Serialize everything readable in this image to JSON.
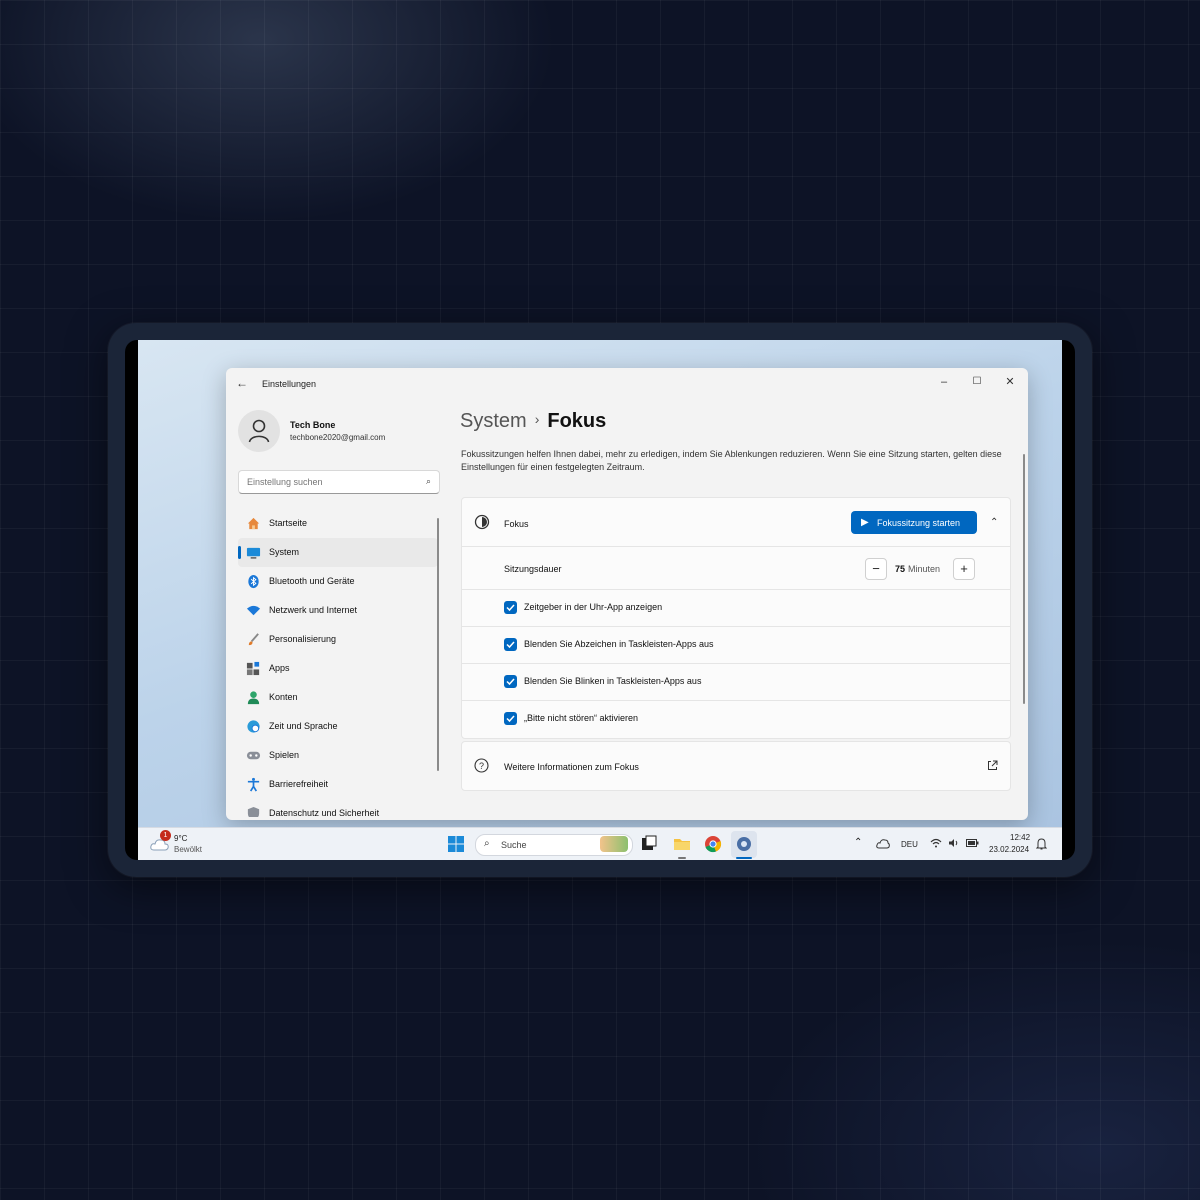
{
  "window": {
    "app_title": "Einstellungen",
    "back_icon": "arrow-left-icon",
    "controls": {
      "minimize": "–",
      "maximize": "☐",
      "close": "✕"
    }
  },
  "profile": {
    "name": "Tech Bone",
    "email": "techbone2020@gmail.com"
  },
  "search": {
    "placeholder": "Einstellung suchen",
    "icon": "search-icon"
  },
  "sidebar": {
    "items": [
      {
        "label": "Startseite",
        "icon": "home-icon"
      },
      {
        "label": "System",
        "icon": "system-icon",
        "active": true
      },
      {
        "label": "Bluetooth und Geräte",
        "icon": "bluetooth-icon"
      },
      {
        "label": "Netzwerk und Internet",
        "icon": "wifi-icon"
      },
      {
        "label": "Personalisierung",
        "icon": "brush-icon"
      },
      {
        "label": "Apps",
        "icon": "apps-icon"
      },
      {
        "label": "Konten",
        "icon": "account-icon"
      },
      {
        "label": "Zeit und Sprache",
        "icon": "globe-clock-icon"
      },
      {
        "label": "Spielen",
        "icon": "gamepad-icon"
      },
      {
        "label": "Barrierefreiheit",
        "icon": "accessibility-icon"
      },
      {
        "label": "Datenschutz und Sicherheit",
        "icon": "shield-icon"
      }
    ]
  },
  "main": {
    "breadcrumb": {
      "parent": "System",
      "separator": "›",
      "current": "Fokus"
    },
    "description": "Fokussitzungen helfen Ihnen dabei, mehr zu erledigen, indem Sie Ablenkungen reduzieren. Wenn Sie eine Sitzung starten, gelten diese Einstellungen für einen festgelegten Zeitraum.",
    "focus_card": {
      "title": "Fokus",
      "start_button": "Fokussitzung starten",
      "duration_label": "Sitzungsdauer",
      "duration_value": "75",
      "duration_unit": "Minuten",
      "minus": "−",
      "plus": "+",
      "options": [
        {
          "label": "Zeitgeber in der Uhr-App anzeigen",
          "checked": true
        },
        {
          "label": "Blenden Sie Abzeichen in Taskleisten-Apps aus",
          "checked": true
        },
        {
          "label": "Blenden Sie Blinken in Taskleisten-Apps aus",
          "checked": true
        },
        {
          "label": "„Bitte nicht stören“ aktivieren",
          "checked": true
        }
      ]
    },
    "info_card": {
      "label": "Weitere Informationen zum Fokus",
      "icon": "external-link-icon"
    }
  },
  "taskbar": {
    "weather": {
      "temp": "9°C",
      "condition": "Bewölkt",
      "badge": "1"
    },
    "search_label": "Suche",
    "language": "DEU",
    "time": "12:42",
    "date": "23.02.2024"
  },
  "colors": {
    "accent": "#0067c0",
    "window_bg": "#f3f3f3"
  }
}
